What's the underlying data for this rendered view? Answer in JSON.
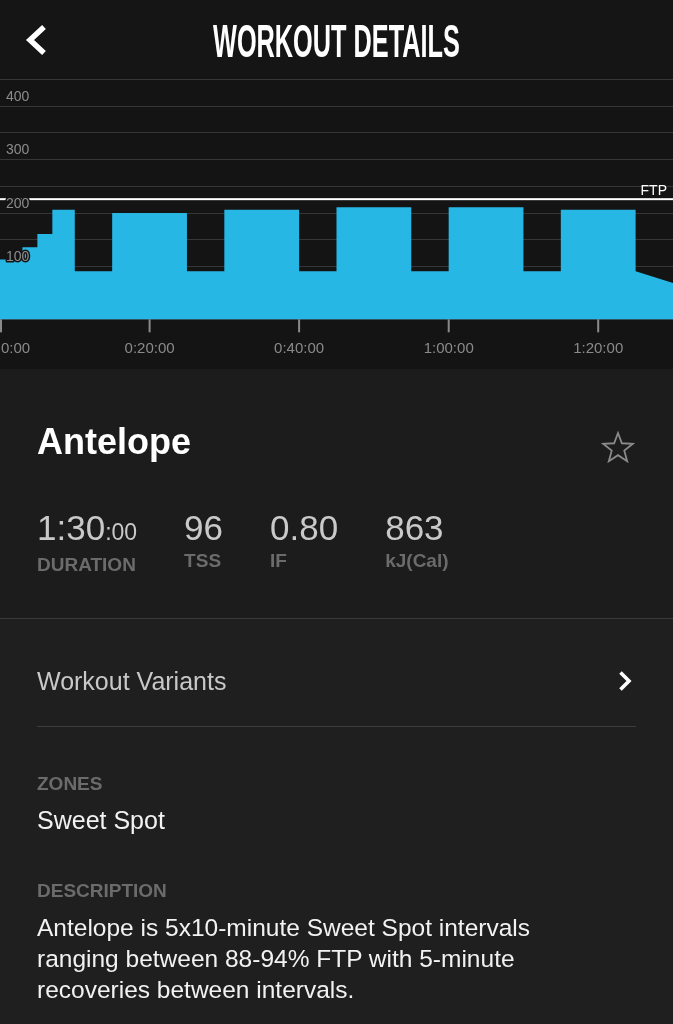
{
  "header": {
    "title": "WORKOUT DETAILS"
  },
  "chart": {
    "chart_data": {
      "type": "area",
      "x": [
        0,
        3,
        3,
        5,
        5,
        7,
        7,
        10,
        10,
        15,
        15,
        25,
        25,
        30,
        30,
        40,
        40,
        45,
        45,
        55,
        55,
        60,
        60,
        70,
        70,
        75,
        75,
        85,
        85,
        90
      ],
      "values": [
        112,
        112,
        135,
        135,
        160,
        160,
        205,
        205,
        90,
        90,
        199,
        199,
        90,
        90,
        205,
        205,
        90,
        90,
        210,
        210,
        90,
        90,
        210,
        210,
        90,
        90,
        205,
        205,
        90,
        68
      ],
      "xlim": [
        0,
        90
      ],
      "ylim": [
        -93,
        450
      ],
      "xticks": [
        {
          "value": 0,
          "label": "0:00"
        },
        {
          "value": 20,
          "label": "0:20:00"
        },
        {
          "value": 40,
          "label": "0:40:00"
        },
        {
          "value": 60,
          "label": "1:00:00"
        },
        {
          "value": 80,
          "label": "1:20:00"
        }
      ],
      "yticks": [
        100,
        200,
        300,
        400
      ],
      "grid": true,
      "ref_lines": [
        {
          "axis": "y",
          "value": 225,
          "label": "FTP"
        }
      ]
    }
  },
  "workout": {
    "name": "Antelope",
    "favorite": false,
    "stats": [
      {
        "value": "1:30",
        "value_small": ":00",
        "label": "DURATION"
      },
      {
        "value": "96",
        "label": "TSS"
      },
      {
        "value": "0.80",
        "label": "IF"
      },
      {
        "value": "863",
        "label": "kJ(Cal)"
      }
    ]
  },
  "variants": {
    "label": "Workout Variants"
  },
  "zones": {
    "heading": "ZONES",
    "value": "Sweet Spot"
  },
  "description": {
    "heading": "DESCRIPTION",
    "text": "Antelope is 5x10-minute Sweet Spot intervals ranging between 88-94% FTP with 5-minute recoveries between intervals."
  }
}
